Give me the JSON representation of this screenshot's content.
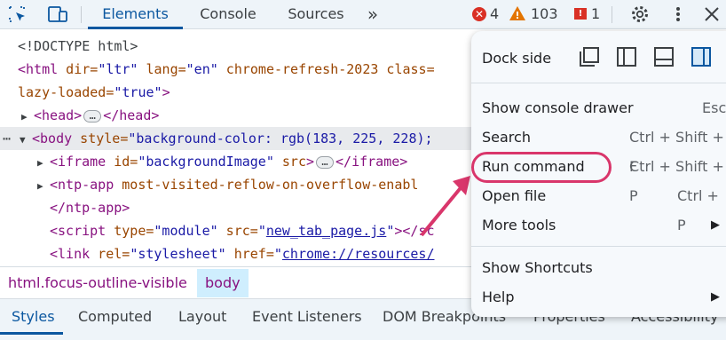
{
  "toolbar": {
    "tabs": [
      "Elements",
      "Console",
      "Sources"
    ],
    "more_tabs": "»",
    "errors": "4",
    "warnings": "103",
    "issues": "1",
    "icons": [
      "inspect-icon",
      "device-toolbar-icon",
      "gear-icon",
      "more-vert-icon",
      "close-icon"
    ]
  },
  "dom": {
    "doctype": "<!DOCTYPE html>",
    "html_open": [
      "<html",
      " dir=",
      "\"ltr\"",
      " lang=",
      "\"en\"",
      " chrome-refresh-2023",
      " class="
    ],
    "lazy": [
      "lazy-loaded=",
      "\"true\"",
      ">"
    ],
    "head": [
      "<head>",
      "</head>"
    ],
    "body_open": [
      "<body",
      " style=",
      "\"background-color: rgb(183, 225, 228);"
    ],
    "iframe": [
      "<iframe",
      " id=",
      "\"backgroundImage\"",
      " src",
      ">",
      "</iframe>"
    ],
    "ntp_open": [
      "<ntp-app",
      " most-visited-reflow-on-overflow-enabl"
    ],
    "ntp_close": "</ntp-app>",
    "script": [
      "<script",
      " type=",
      "\"module\"",
      " src=",
      "\"",
      "new_tab_page.js",
      "\"",
      "></sc"
    ],
    "link": [
      "<link",
      " rel=",
      "\"stylesheet\"",
      " href=",
      "\"",
      "chrome://resources/"
    ],
    "ellipsis": "…"
  },
  "breadcrumbs": [
    "html.focus-outline-visible",
    "body"
  ],
  "bottom_tabs": [
    "Styles",
    "Computed",
    "Layout",
    "Event Listeners",
    "DOM Breakpoints",
    "Properties",
    "Accessibility"
  ],
  "menu": {
    "dock_label": "Dock side",
    "items": [
      {
        "label": "Show console drawer",
        "shortcut": "Esc"
      },
      {
        "label": "Search",
        "shortcut": "Ctrl + Shift + F"
      },
      {
        "label": "Run command",
        "shortcut": "Ctrl + Shift + P"
      },
      {
        "label": "Open file",
        "shortcut": "Ctrl + P"
      },
      {
        "label": "More tools",
        "arrow": "▶"
      },
      {
        "label": "Show Shortcuts"
      },
      {
        "label": "Help",
        "arrow": "▶"
      }
    ]
  },
  "colors": {
    "accent": "#0b57a0",
    "highlight_ring": "#d9366b",
    "error": "#d93025",
    "warning": "#e37400"
  }
}
